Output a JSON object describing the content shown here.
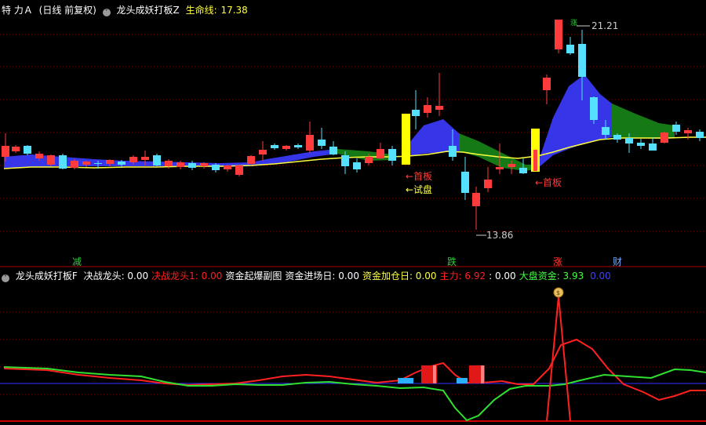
{
  "main_header": {
    "stock": "特 力Ａ",
    "period": "(日线 前复权)",
    "indicator": "龙头成妖打板Z",
    "lifeline_label": "生命线:",
    "lifeline_value": "17.38"
  },
  "annotations": {
    "high_price": "21.21",
    "low_price": "13.86",
    "first_board_1": "←首板",
    "trial_board": "←试盘",
    "first_board_2": "←首板",
    "sign_small": "涨"
  },
  "markers": [
    {
      "label": "减",
      "color": "#2ecc40"
    },
    {
      "label": "跌",
      "color": "#2ecc40"
    },
    {
      "label": "涨",
      "color": "#ff3b3b"
    },
    {
      "label": "财",
      "color": "#6fa8ff"
    }
  ],
  "sub_header": {
    "indicator": "龙头成妖打板F",
    "items": [
      {
        "label": "决战龙头:",
        "value": "0.00",
        "color": "#ffffff"
      },
      {
        "label": "决战龙头1:",
        "value": "0.00",
        "color": "#ff2020"
      },
      {
        "label": "资金起爆副图",
        "value": "",
        "color": "#ffffff"
      },
      {
        "label": "资金进场日:",
        "value": "0.00",
        "color": "#ffffff"
      },
      {
        "label": "资金加仓日:",
        "value": "0.00",
        "color": "#ffff40"
      },
      {
        "label": "主力:",
        "value": "6.92",
        "color": "#ff2020"
      },
      {
        "label": ":",
        "value": "0.00",
        "color": "#ffffff"
      },
      {
        "label": "大盘资金:",
        "value": "3.93",
        "color": "#40ff40"
      },
      {
        "label": "",
        "value": "0.00",
        "color": "#4040ff"
      }
    ]
  },
  "colors": {
    "up": "#ff3b3b",
    "down": "#55e0ff",
    "lifeline": "#ffff40",
    "band_up": "#3b3bff",
    "band_down": "#1a7a1a",
    "grid": "#8b0000"
  },
  "icons": {
    "dropdown": "chevron-circle-icon",
    "money_bag": "money-bag-icon"
  }
}
